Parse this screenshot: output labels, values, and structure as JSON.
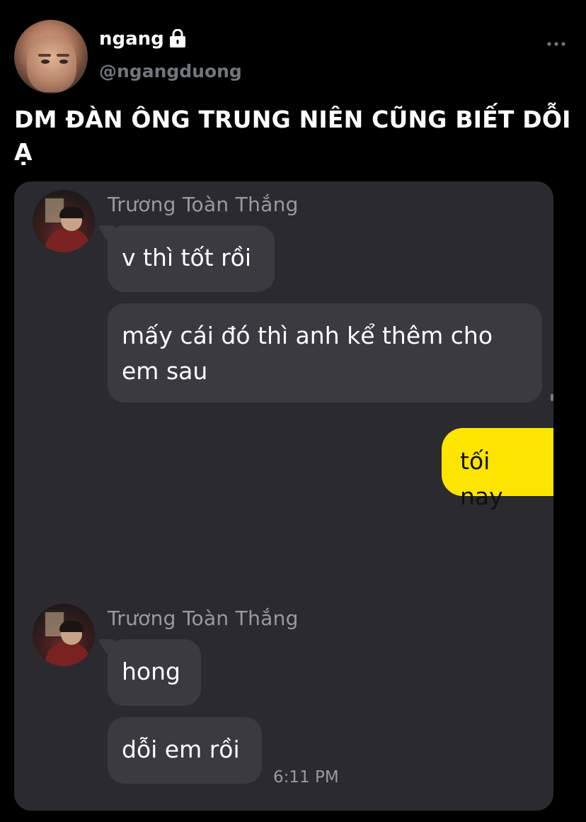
{
  "tweet": {
    "author": {
      "display_name": "ngang",
      "handle": "@ngangduong",
      "protected_icon": "lock-icon"
    },
    "more_icon": "ellipsis-icon",
    "text": "DM ĐÀN ÔNG TRUNG NIÊN CŨNG BIẾT DỖI Ạ"
  },
  "chat": {
    "groups": [
      {
        "sender": "Trương Toàn Thắng",
        "messages": [
          "v thì tốt rồi",
          "mấy cái đó thì anh kể thêm cho em sau"
        ]
      },
      {
        "sent": [
          "tối nay"
        ]
      },
      {
        "sender": "Trương Toàn Thắng",
        "messages": [
          "hong",
          "dỗi em rồi"
        ],
        "time": "6:11 PM"
      }
    ]
  },
  "colors": {
    "background": "#000000",
    "chat_background": "#2b2a2f",
    "received_bubble": "#3b3a3f",
    "sent_bubble": "#fde500",
    "muted_text": "#71767b"
  }
}
